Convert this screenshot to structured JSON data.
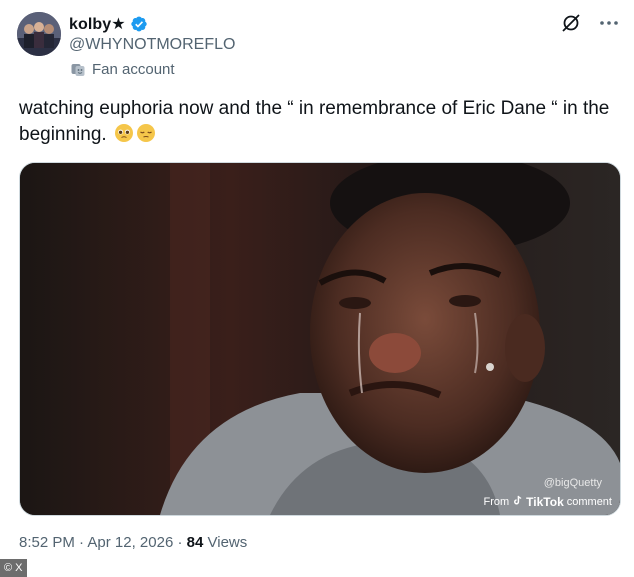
{
  "user": {
    "display_name": "kolby★",
    "handle": "@WHYNOTMOREFLO",
    "label": "Fan account",
    "verified_color": "#1d9bf0"
  },
  "tweet": {
    "text": "watching euphoria now and the “ in remembrance of Eric Dane “ in the beginning.",
    "emojis": [
      "pleading-face-emoji",
      "pensive-face-emoji"
    ]
  },
  "media": {
    "watermark_user": "@bigQuetty",
    "watermark_from": "From",
    "watermark_brand": "TikTok",
    "watermark_suffix": "comment"
  },
  "meta": {
    "time": "8:52 PM",
    "date": "Apr 12, 2026",
    "separator": "·",
    "views_count": "84",
    "views_label": "Views"
  },
  "credit": "© X"
}
